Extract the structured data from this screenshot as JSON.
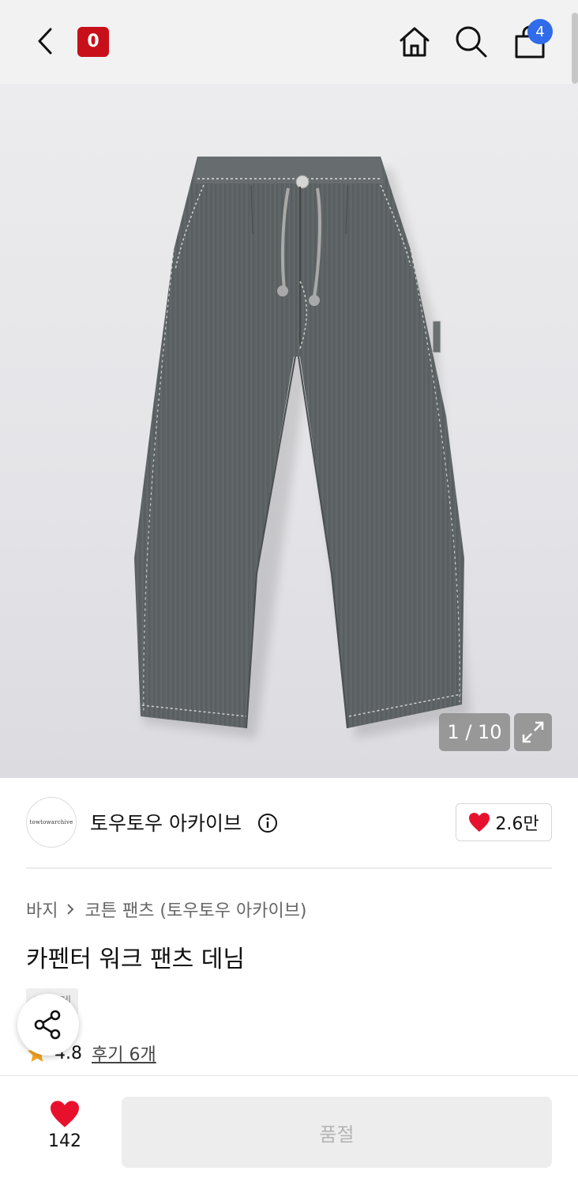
{
  "header": {
    "logo_text": "0",
    "cart_count": "4",
    "icons": [
      "back-icon",
      "home-icon",
      "search-icon",
      "shopping-bag-icon"
    ]
  },
  "gallery": {
    "counter": "1 / 10",
    "background_color": "#e6e6ea",
    "denim_color": "#5e6366"
  },
  "brand": {
    "avatar_text": "towtowarchive",
    "name": "토우토우 아카이브",
    "like_count": "2.6만"
  },
  "product": {
    "breadcrumb": [
      "바지",
      "코튼 팬츠 (토우토우 아카이브)"
    ],
    "title": "카펜터 워크 팬츠 데님",
    "tag": "아울렛",
    "rating": "4.8",
    "reviews": "후기 6개"
  },
  "bottom_bar": {
    "wish_count": "142",
    "buy_label": "품절"
  },
  "colors": {
    "brand_red": "#c8101a",
    "heart_red": "#e8112d",
    "badge_blue": "#2f6bea",
    "star_orange": "#f5a623"
  }
}
